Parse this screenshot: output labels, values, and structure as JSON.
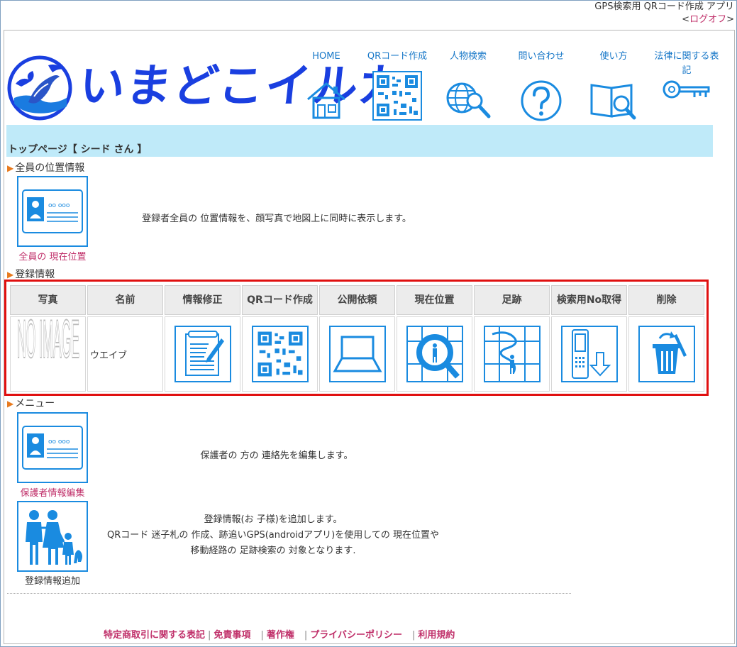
{
  "topbar": {
    "line1": "GPS検索用 QRコード作成 アプリ",
    "logoff_open": "<",
    "logoff": "ログオフ",
    "logoff_close": ">"
  },
  "logo": {
    "text": "いまどこイルカ"
  },
  "nav": {
    "items": [
      {
        "label": "HOME",
        "icon": "house-icon"
      },
      {
        "label": "QRコード作成",
        "icon": "qr-code-icon"
      },
      {
        "label": "人物検索",
        "icon": "globe-search-icon"
      },
      {
        "label": "問い合わせ",
        "icon": "question-icon"
      },
      {
        "label": "使い方",
        "icon": "book-search-icon"
      },
      {
        "label": "法律に関する表記",
        "icon": "key-icon"
      }
    ]
  },
  "title": {
    "text": "トップページ【 シード さん 】"
  },
  "sections": {
    "all_location": {
      "heading": "全員の位置情報",
      "tile_caption": "全員の 現在位置",
      "description": "登録者全員の 位置情報を、顔写真で地図上に同時に表示します。"
    },
    "registration": {
      "heading": "登録情報",
      "headers": [
        "写真",
        "名前",
        "情報修正",
        "QRコード作成",
        "公開依頼",
        "現在位置",
        "足跡",
        "検索用No取得",
        "削除"
      ],
      "row": {
        "photo": "NO IMAGE",
        "name": "ウエイブ"
      }
    },
    "menu": {
      "heading": "メニュー",
      "guardian_caption": "保護者情報編集",
      "guardian_desc": "保護者の 方の 連絡先を編集します。",
      "add_caption": "登録情報追加",
      "add_desc_1": "登録情報(お 子様)を追加します。",
      "add_desc_2": "QRコード 迷子札の 作成、跡追いGPS(androidアプリ)を使用しての 現在位置や",
      "add_desc_3": "移動経路の 足跡検索の 対象となります."
    }
  },
  "footer": {
    "links": [
      "特定商取引に関する表記",
      "免責事項",
      "著作権",
      "プライバシーポリシー",
      "利用規約"
    ]
  },
  "colors": {
    "accent_blue": "#1a8be0",
    "logo_blue": "#1a3fe0",
    "link_pink": "#c0306a",
    "title_bar": "#bfeaf9",
    "highlight_red": "#e01010"
  }
}
